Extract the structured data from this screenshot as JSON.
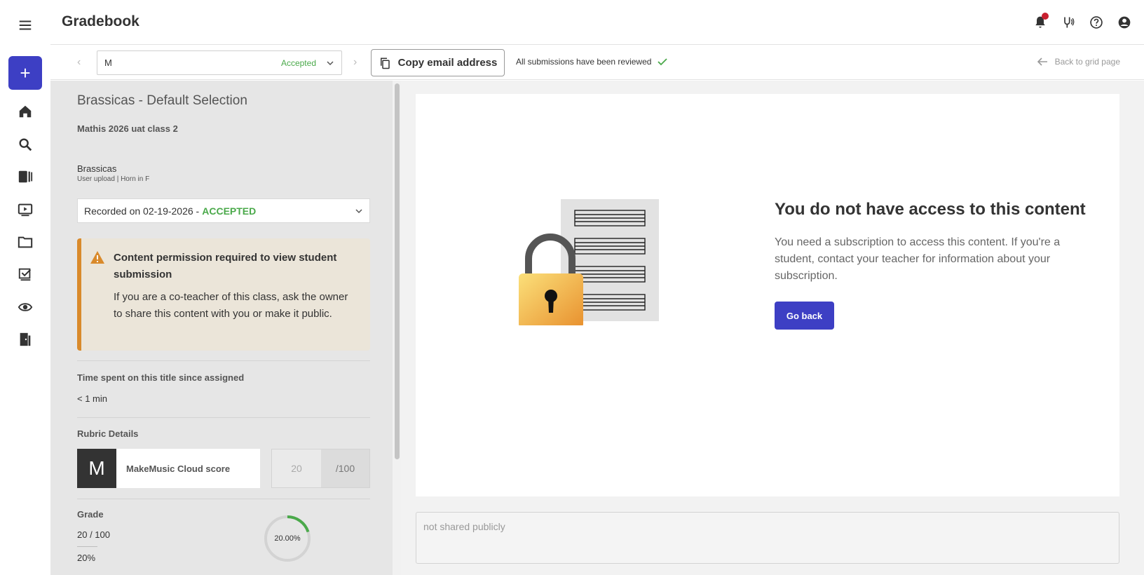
{
  "app": {
    "title": "Gradebook"
  },
  "rail": {
    "add_label": "+",
    "items": [
      {
        "name": "menu-icon"
      },
      {
        "name": "home-icon"
      },
      {
        "name": "search-icon"
      },
      {
        "name": "library-icon"
      },
      {
        "name": "video-icon"
      },
      {
        "name": "folder-icon"
      },
      {
        "name": "assignments-icon"
      },
      {
        "name": "view-icon"
      },
      {
        "name": "exit-icon"
      }
    ]
  },
  "header_icons": [
    "bell-icon",
    "tuner-icon",
    "help-icon",
    "account-icon"
  ],
  "toolbar": {
    "student_value": "M",
    "student_status": "Accepted",
    "copy_label": "Copy email address",
    "reviewed_text": "All submissions have been reviewed",
    "back_label": "Back to grid page"
  },
  "left": {
    "assignment_title": "Brassicas - Default Selection",
    "class_name": "Mathis 2026 uat class 2",
    "piece_name": "Brassicas",
    "piece_sub": "User upload | Horn in F",
    "recording": {
      "prefix": "Recorded on 02-19-2026 - ",
      "status": "ACCEPTED"
    },
    "warning": {
      "title": "Content permission required to view student submission",
      "body": "If you are a co-teacher of this class, ask the owner to share this content with you or make it public."
    },
    "time_label": "Time spent on this title since assigned",
    "time_value": "< 1 min",
    "rubric_label": "Rubric Details",
    "rubric": {
      "initial": "M",
      "name": "MakeMusic Cloud score",
      "score": "20",
      "max": "/100"
    },
    "grade_label": "Grade",
    "grade_value": "20 / 100",
    "grade_percent": "20%",
    "ring_label": "20.00%",
    "ring_fraction": 0.2,
    "ring_color": "#4aa94a"
  },
  "right": {
    "title": "You do not have access to this content",
    "body": "You need a subscription to access this content. If you're a student, contact your teacher for information about your subscription.",
    "go_back": "Go back",
    "share_placeholder": "not shared publicly"
  },
  "colors": {
    "primary": "#3d3fc4",
    "accepted": "#4aa94a",
    "warning": "#d98a2b",
    "notification": "#c8202f"
  }
}
